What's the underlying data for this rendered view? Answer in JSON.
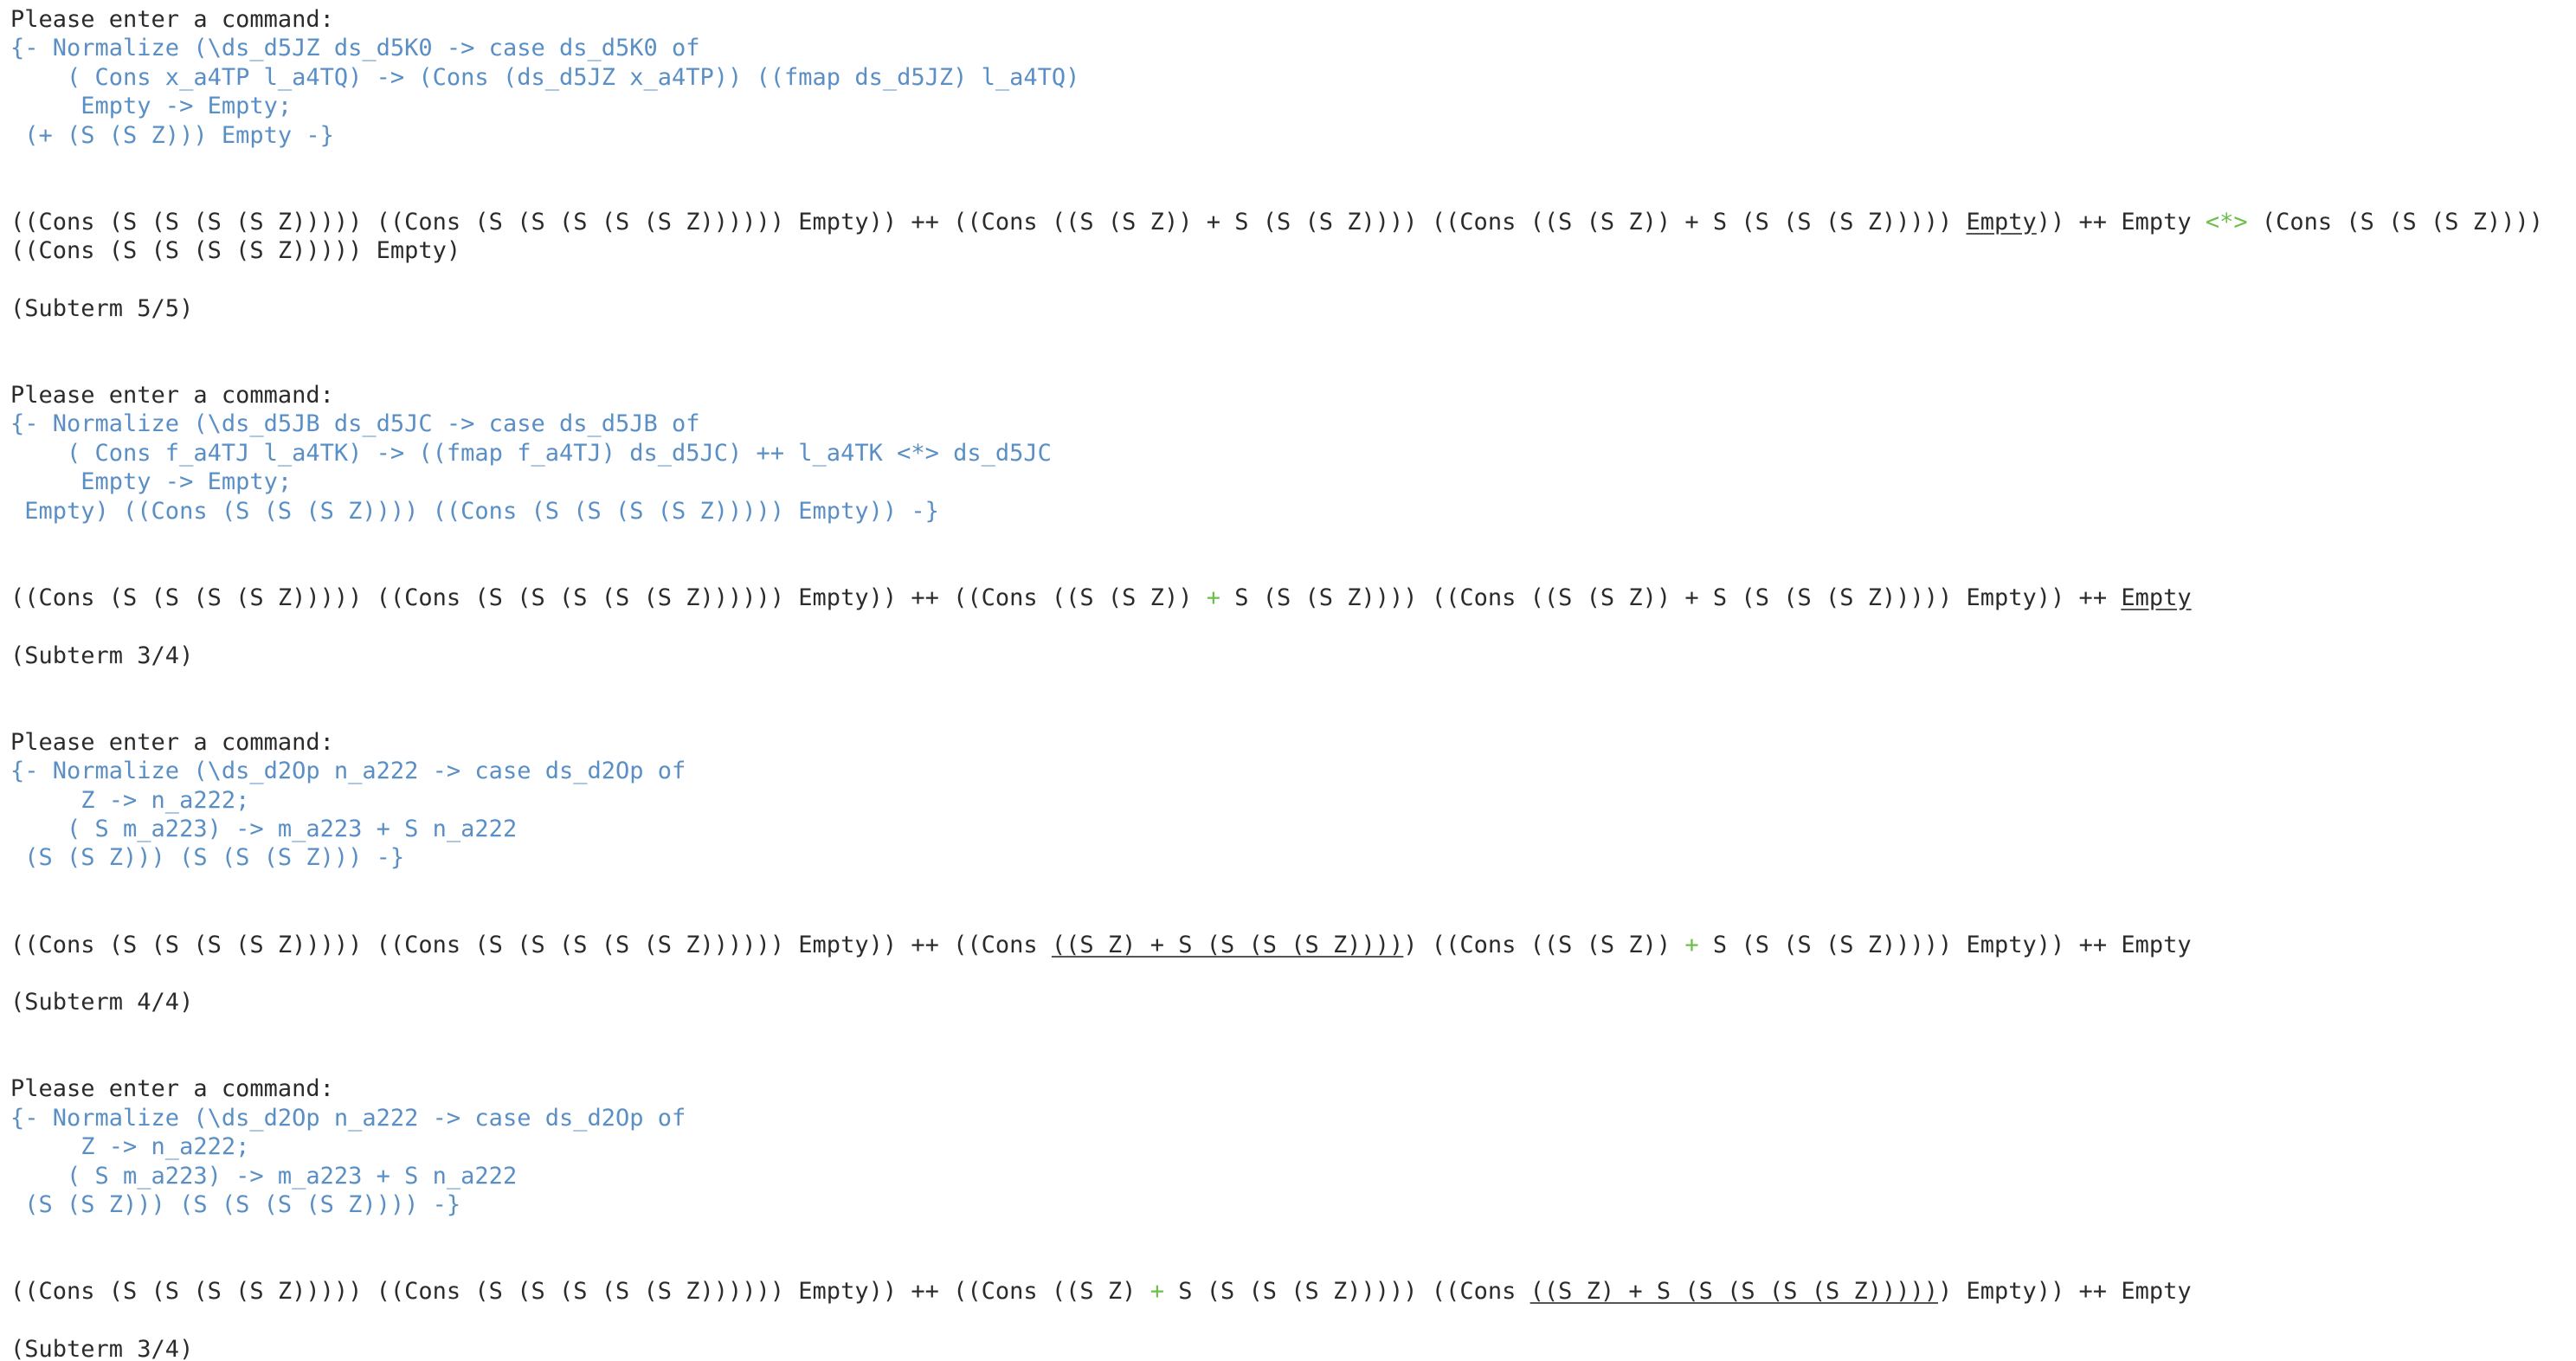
{
  "colors": {
    "background": "#ffffff",
    "text": "#2b2b2b",
    "comment": "#5a8fc6",
    "highlight": "#6cc04a"
  },
  "lines": [
    {
      "name": "prompt-line",
      "segs": [
        {
          "t": "Please enter a command:"
        }
      ]
    },
    {
      "name": "comment-line",
      "segs": [
        {
          "t": "{- Normalize (\\ds_d5JZ ds_d5K0 -> case ds_d5K0 of",
          "s": "comment"
        }
      ]
    },
    {
      "name": "comment-line",
      "segs": [
        {
          "t": "    ( Cons x_a4TP l_a4TQ) -> (Cons (ds_d5JZ x_a4TP)) ((fmap ds_d5JZ) l_a4TQ)",
          "s": "comment"
        }
      ]
    },
    {
      "name": "comment-line",
      "segs": [
        {
          "t": "     Empty -> Empty;",
          "s": "comment"
        }
      ]
    },
    {
      "name": "comment-line",
      "segs": [
        {
          "t": " (+ (S (S Z))) Empty -}",
          "s": "comment"
        }
      ]
    },
    {
      "name": "blank-line",
      "segs": []
    },
    {
      "name": "blank-line",
      "segs": []
    },
    {
      "name": "term-line",
      "segs": [
        {
          "t": "((Cons (S (S (S (S Z))))) ((Cons (S (S (S (S (S Z)))))) Empty)) ++ ((Cons ((S (S Z)) + S (S (S Z)))) ((Cons ((S (S Z)) + S (S (S (S Z))))) "
        },
        {
          "t": "Empty",
          "s": "ul"
        },
        {
          "t": ")) ++ Empty "
        },
        {
          "t": "<*>",
          "s": "hl"
        },
        {
          "t": " (Cons (S (S (S Z))))"
        }
      ]
    },
    {
      "name": "term-line",
      "segs": [
        {
          "t": "((Cons (S (S (S (S Z))))) Empty)"
        }
      ]
    },
    {
      "name": "blank-line",
      "segs": []
    },
    {
      "name": "subterm-line",
      "segs": [
        {
          "t": "(Subterm 5/5)"
        }
      ]
    },
    {
      "name": "blank-line",
      "segs": []
    },
    {
      "name": "blank-line",
      "segs": []
    },
    {
      "name": "prompt-line",
      "segs": [
        {
          "t": "Please enter a command:"
        }
      ]
    },
    {
      "name": "comment-line",
      "segs": [
        {
          "t": "{- Normalize (\\ds_d5JB ds_d5JC -> case ds_d5JB of",
          "s": "comment"
        }
      ]
    },
    {
      "name": "comment-line",
      "segs": [
        {
          "t": "    ( Cons f_a4TJ l_a4TK) -> ((fmap f_a4TJ) ds_d5JC) ++ l_a4TK <*> ds_d5JC",
          "s": "comment"
        }
      ]
    },
    {
      "name": "comment-line",
      "segs": [
        {
          "t": "     Empty -> Empty;",
          "s": "comment"
        }
      ]
    },
    {
      "name": "comment-line",
      "segs": [
        {
          "t": " Empty) ((Cons (S (S (S Z)))) ((Cons (S (S (S (S Z))))) Empty)) -}",
          "s": "comment"
        }
      ]
    },
    {
      "name": "blank-line",
      "segs": []
    },
    {
      "name": "blank-line",
      "segs": []
    },
    {
      "name": "term-line",
      "segs": [
        {
          "t": "((Cons (S (S (S (S Z))))) ((Cons (S (S (S (S (S Z)))))) Empty)) ++ ((Cons ((S (S Z)) "
        },
        {
          "t": "+",
          "s": "hl"
        },
        {
          "t": " S (S (S Z)))) ((Cons ((S (S Z)) + S (S (S (S Z))))) Empty)) ++ "
        },
        {
          "t": "Empty",
          "s": "ul"
        }
      ]
    },
    {
      "name": "blank-line",
      "segs": []
    },
    {
      "name": "subterm-line",
      "segs": [
        {
          "t": "(Subterm 3/4)"
        }
      ]
    },
    {
      "name": "blank-line",
      "segs": []
    },
    {
      "name": "blank-line",
      "segs": []
    },
    {
      "name": "prompt-line",
      "segs": [
        {
          "t": "Please enter a command:"
        }
      ]
    },
    {
      "name": "comment-line",
      "segs": [
        {
          "t": "{- Normalize (\\ds_d2Op n_a222 -> case ds_d2Op of",
          "s": "comment"
        }
      ]
    },
    {
      "name": "comment-line",
      "segs": [
        {
          "t": "     Z -> n_a222;",
          "s": "comment"
        }
      ]
    },
    {
      "name": "comment-line",
      "segs": [
        {
          "t": "    ( S m_a223) -> m_a223 + S n_a222",
          "s": "comment"
        }
      ]
    },
    {
      "name": "comment-line",
      "segs": [
        {
          "t": " (S (S Z))) (S (S (S Z))) -}",
          "s": "comment"
        }
      ]
    },
    {
      "name": "blank-line",
      "segs": []
    },
    {
      "name": "blank-line",
      "segs": []
    },
    {
      "name": "term-line",
      "segs": [
        {
          "t": "((Cons (S (S (S (S Z))))) ((Cons (S (S (S (S (S Z)))))) Empty)) ++ ((Cons "
        },
        {
          "t": "((S Z) + S (S (S (S Z))))",
          "s": "ul"
        },
        {
          "t": ") ((Cons ((S (S Z)) "
        },
        {
          "t": "+",
          "s": "hl"
        },
        {
          "t": " S (S (S (S Z))))) Empty)) ++ Empty"
        }
      ]
    },
    {
      "name": "blank-line",
      "segs": []
    },
    {
      "name": "subterm-line",
      "segs": [
        {
          "t": "(Subterm 4/4)"
        }
      ]
    },
    {
      "name": "blank-line",
      "segs": []
    },
    {
      "name": "blank-line",
      "segs": []
    },
    {
      "name": "prompt-line",
      "segs": [
        {
          "t": "Please enter a command:"
        }
      ]
    },
    {
      "name": "comment-line",
      "segs": [
        {
          "t": "{- Normalize (\\ds_d2Op n_a222 -> case ds_d2Op of",
          "s": "comment"
        }
      ]
    },
    {
      "name": "comment-line",
      "segs": [
        {
          "t": "     Z -> n_a222;",
          "s": "comment"
        }
      ]
    },
    {
      "name": "comment-line",
      "segs": [
        {
          "t": "    ( S m_a223) -> m_a223 + S n_a222",
          "s": "comment"
        }
      ]
    },
    {
      "name": "comment-line",
      "segs": [
        {
          "t": " (S (S Z))) (S (S (S (S Z)))) -}",
          "s": "comment"
        }
      ]
    },
    {
      "name": "blank-line",
      "segs": []
    },
    {
      "name": "blank-line",
      "segs": []
    },
    {
      "name": "term-line",
      "segs": [
        {
          "t": "((Cons (S (S (S (S Z))))) ((Cons (S (S (S (S (S Z)))))) Empty)) ++ ((Cons ((S Z) "
        },
        {
          "t": "+",
          "s": "hl"
        },
        {
          "t": " S (S (S (S Z))))) ((Cons "
        },
        {
          "t": "((S Z) + S (S (S (S (S Z)))))",
          "s": "ul"
        },
        {
          "t": ") Empty)) ++ Empty"
        }
      ]
    },
    {
      "name": "blank-line",
      "segs": []
    },
    {
      "name": "subterm-line",
      "segs": [
        {
          "t": "(Subterm 3/4)"
        }
      ]
    }
  ]
}
